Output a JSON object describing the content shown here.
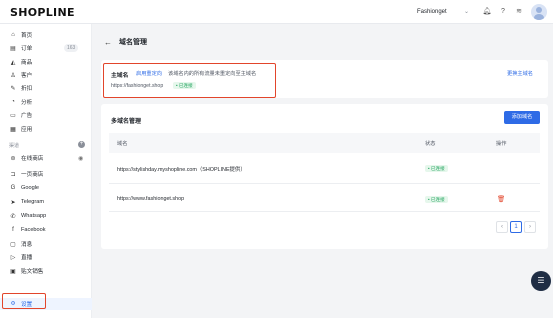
{
  "topbar": {
    "logo": "SHOPLINE",
    "store_name": "Fashionget",
    "store_chevron": "⌄",
    "icons": [
      "bell-icon",
      "help-icon",
      "wifi-icon"
    ]
  },
  "sidebar": {
    "items": [
      {
        "label": "首页",
        "icon": "home-icon",
        "glyph": "⌂"
      },
      {
        "label": "订单",
        "icon": "order-icon",
        "glyph": "▤",
        "count": "163"
      },
      {
        "label": "商品",
        "icon": "bag-icon",
        "glyph": "◭"
      },
      {
        "label": "客户",
        "icon": "user-icon",
        "glyph": "♙"
      },
      {
        "label": "折扣",
        "icon": "tag-icon",
        "glyph": "✎"
      },
      {
        "label": "分析",
        "icon": "analytics-icon",
        "glyph": "◔"
      },
      {
        "label": "广告",
        "icon": "ads-icon",
        "glyph": "▭"
      },
      {
        "label": "应用",
        "icon": "apps-icon",
        "glyph": "▦"
      }
    ],
    "channels_label": "渠道",
    "channel_add": "+",
    "channels": [
      {
        "label": "在线商店",
        "icon": "store-icon",
        "glyph": "⊜"
      },
      {
        "label": "一页商店",
        "icon": "page-store-icon",
        "glyph": "⊐"
      },
      {
        "label": "Google",
        "icon": "google-icon",
        "glyph": "G"
      },
      {
        "label": "Telegram",
        "icon": "telegram-icon",
        "glyph": "➤"
      },
      {
        "label": "Whatsapp",
        "icon": "whatsapp-icon",
        "glyph": "✆"
      },
      {
        "label": "Facebook",
        "icon": "facebook-icon",
        "glyph": "f"
      },
      {
        "label": "消息",
        "icon": "message-icon",
        "glyph": "▢"
      },
      {
        "label": "直播",
        "icon": "live-icon",
        "glyph": "▷"
      },
      {
        "label": "贴文销售",
        "icon": "post-sales-icon",
        "glyph": "▣"
      }
    ],
    "settings": {
      "label": "设置",
      "glyph": "⚙"
    }
  },
  "header": {
    "back": "←",
    "title": "域名管理"
  },
  "primary": {
    "label": "主域名",
    "redirect_link": "启用重定向",
    "redirect_desc": "该域名内的所有流量未重定向至主域名",
    "domain": "https://fashionget.shop",
    "badge": "• 已连接",
    "change_link": "更换主域名"
  },
  "multi": {
    "title": "多域名管理",
    "add_button": "添加域名",
    "columns": [
      "域名",
      "状态",
      "操作"
    ],
    "rows": [
      {
        "domain": "https://stylishday.myshopline.com（SHOPLINE提供）",
        "status": "• 已连接",
        "action": ""
      },
      {
        "domain": "https://www.fashionget.shop",
        "status": "• 已连接",
        "action": "delete"
      }
    ]
  },
  "pagination": {
    "prev": "‹",
    "page": "1",
    "next": "›"
  },
  "chat": {
    "glyph": "☰"
  }
}
